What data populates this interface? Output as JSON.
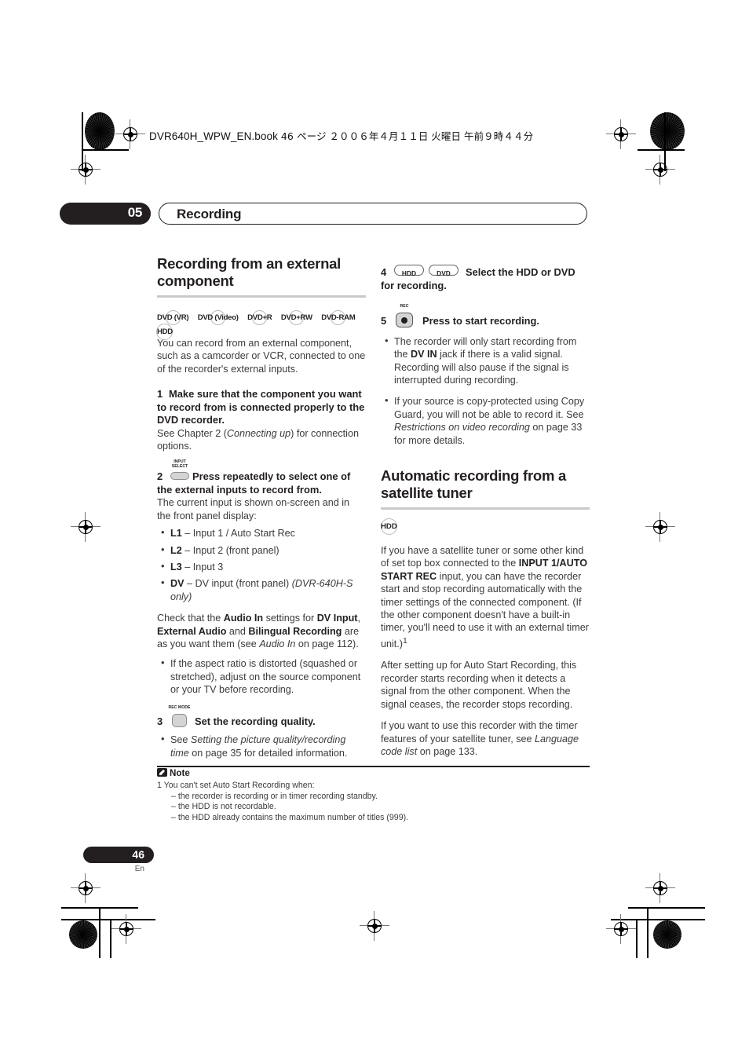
{
  "print_header": {
    "filename": "DVR640H_WPW_EN.book",
    "page_ref": "46 ページ",
    "date": "２００６年４月１１日",
    "weekday": "火曜日",
    "time": "午前９時４４分"
  },
  "chapter": {
    "number": "05",
    "title": "Recording"
  },
  "left_column": {
    "heading": "Recording from an external component",
    "disc_badges": [
      "DVD (VR)",
      "DVD (Video)",
      "DVD+R",
      "DVD+RW",
      "DVD-RAM",
      "HDD"
    ],
    "intro": "You can record from an external component, such as a camcorder or VCR, connected to one of the recorder's external inputs.",
    "step1": {
      "number": "1",
      "bold_text": "Make sure that the component you want to record from is connected properly to the DVD recorder.",
      "follow_plain_1": "See Chapter 2 (",
      "follow_italic": "Connecting up",
      "follow_plain_2": ") for connection options."
    },
    "step2": {
      "number": "2",
      "key_label_line1": "INPUT",
      "key_label_line2": "SELECT",
      "bold_text": "Press repeatedly to select one of the external inputs to record from.",
      "follow": "The current input is shown on-screen and in the front panel display:",
      "bullets": [
        {
          "bold": "L1",
          "rest": " – Input 1 / Auto Start Rec"
        },
        {
          "bold": "L2",
          "rest": " – Input 2 (front panel)"
        },
        {
          "bold": "L3",
          "rest": " – Input 3"
        },
        {
          "bold": "DV",
          "rest": " – DV input (front panel) ",
          "italic": "(DVR-640H-S only)"
        }
      ],
      "check_plain_1": "Check that the ",
      "check_bold_1": "Audio In",
      "check_plain_2": " settings for ",
      "check_bold_2": "DV Input",
      "check_plain_3": ", ",
      "check_bold_3": "External Audio",
      "check_plain_4": " and ",
      "check_bold_4": "Bilingual Recording",
      "check_plain_5": " are as you want them (see ",
      "check_italic": "Audio In",
      "check_plain_6": " on page 112).",
      "aspect_bullet": "If the aspect ratio is distorted (squashed or stretched), adjust on the source component or your TV before recording."
    },
    "step3": {
      "number": "3",
      "key_label": "REC MODE",
      "bold_text": "Set the recording quality.",
      "bullet_plain_1": "See ",
      "bullet_italic": "Setting the picture quality/recording time",
      "bullet_plain_2": " on page 35 for detailed information."
    }
  },
  "right_column": {
    "step4": {
      "number": "4",
      "key_hdd": "HDD",
      "key_dvd": "DVD",
      "bold_text": "Select the HDD or DVD for recording."
    },
    "step5": {
      "number": "5",
      "key_label": "REC",
      "bold_text": "Press to start recording.",
      "bullets": [
        {
          "plain_1": "The recorder will only start recording from the ",
          "bold": "DV IN",
          "plain_2": " jack if there is a valid signal. Recording will also pause if the signal is interrupted during recording."
        },
        {
          "plain_1": "If your source is copy-protected using Copy Guard, you will not be able to record it. See ",
          "italic": "Restrictions on video recording",
          "plain_2": " on page 33 for more details."
        }
      ]
    },
    "heading2": "Automatic recording from a satellite tuner",
    "disc_badge": "HDD",
    "para1_plain_1": "If you have a satellite tuner or some other kind of set top box connected to the ",
    "para1_bold": "INPUT 1/AUTO START REC",
    "para1_plain_2": " input, you can have the recorder start and stop recording automatically with the timer settings of the connected component. (If the other component doesn't have a built-in timer, you'll need to use it with an external timer unit.)",
    "para1_superscript": "1",
    "para2": "After setting up for Auto Start Recording, this recorder starts recording when it detects a signal from the other component. When the signal ceases, the recorder stops recording.",
    "para3_plain_1": "If you want to use this recorder with the timer features of your satellite tuner, see ",
    "para3_italic": "Language code list",
    "para3_plain_2": " on page 133."
  },
  "note": {
    "title": "Note",
    "item": "1 You can't set Auto Start Recording when:",
    "subitems": [
      "– the recorder is recording or in timer recording standby.",
      "– the HDD is not recordable.",
      "– the HDD already contains the maximum number of titles (999)."
    ]
  },
  "footer": {
    "page_number": "46",
    "language": "En"
  }
}
